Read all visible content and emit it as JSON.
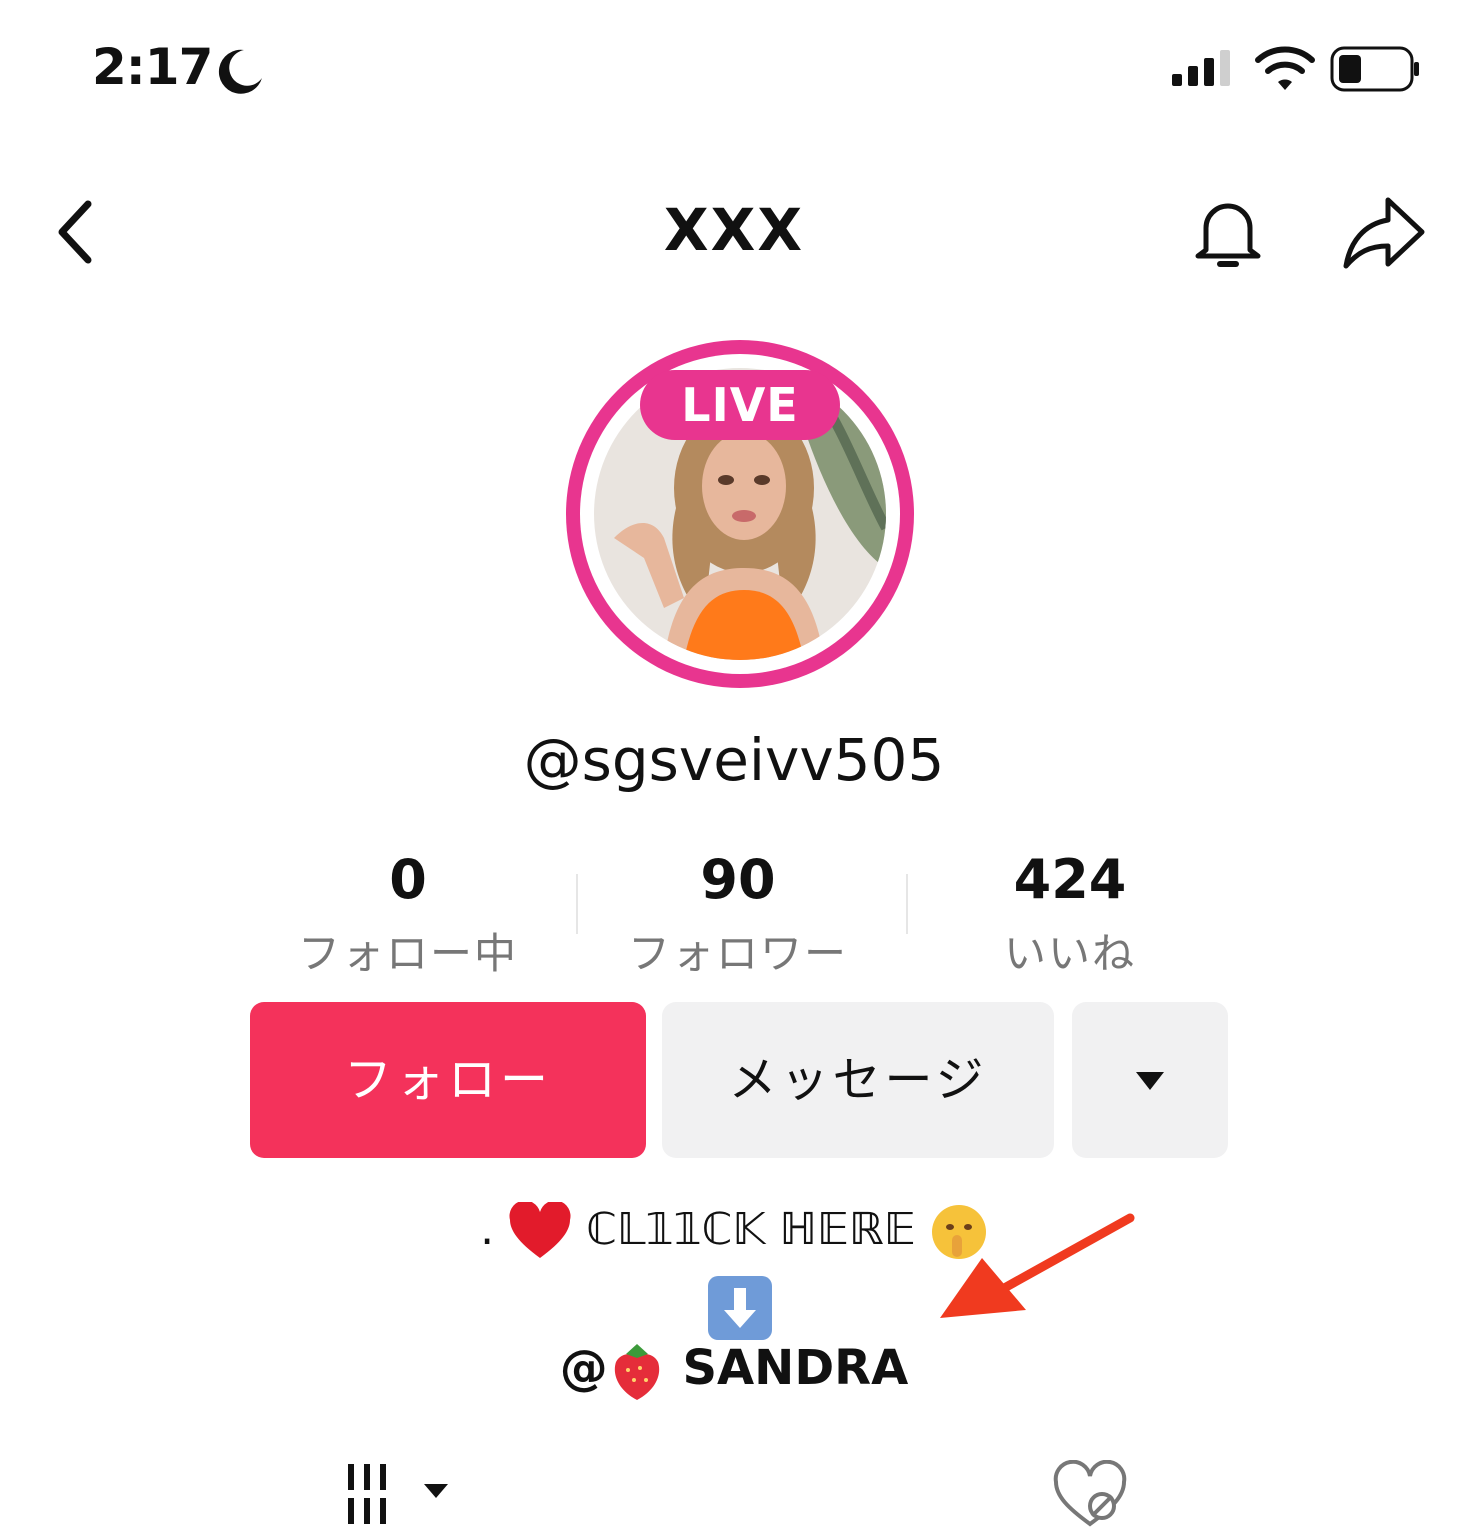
{
  "status_bar": {
    "time": "2:17",
    "icons": [
      "moon-icon",
      "signal-icon",
      "wifi-icon",
      "battery-icon"
    ]
  },
  "nav": {
    "title": "XXX",
    "icons": [
      "back-chevron-icon",
      "bell-icon",
      "share-icon"
    ]
  },
  "profile": {
    "live_badge": "LIVE",
    "handle": "@sgsveivv505"
  },
  "stats": [
    {
      "value": "0",
      "label": "フォロー中"
    },
    {
      "value": "90",
      "label": "フォロワー"
    },
    {
      "value": "424",
      "label": "いいね"
    }
  ],
  "actions": {
    "follow_label": "フォロー",
    "message_label": "メッセージ",
    "more_icon": "caret-down-icon"
  },
  "bio": {
    "line1_prefix": ".",
    "line1_text": "ℂ𝕃𝟙𝟙ℂ𝕂 ℍ𝔼ℝ𝔼",
    "line3_prefix": "@",
    "line3_text": "SANDRA"
  },
  "tabs": {
    "icons": [
      "videos-grid-icon",
      "liked-hidden-icon"
    ]
  },
  "colors": {
    "live_pink": "#e8358f",
    "follow_red": "#f4325b",
    "secondary_button": "#f1f1f2",
    "annotation_arrow": "#f03a1f"
  }
}
